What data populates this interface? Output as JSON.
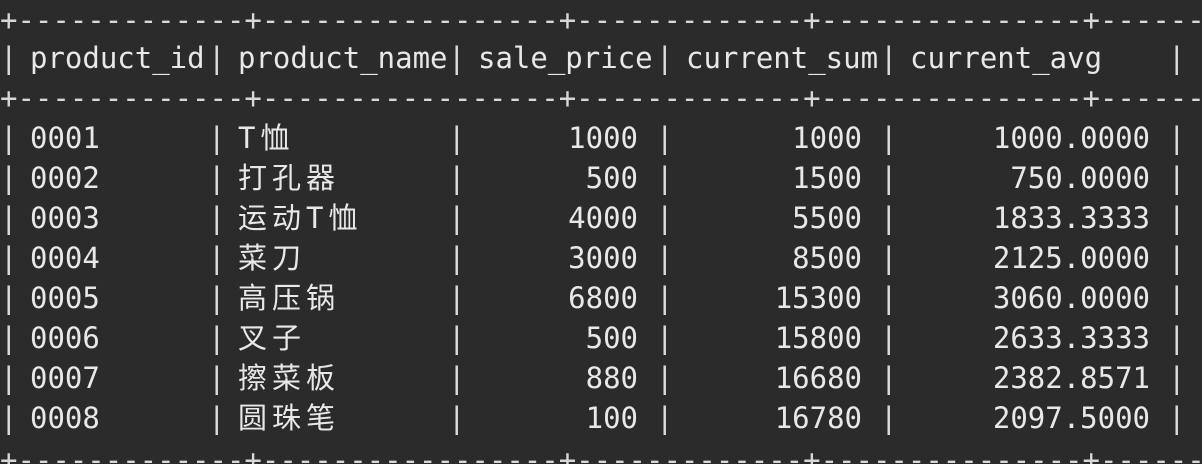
{
  "table": {
    "border_top": "+-------------+-----------------+-------------+---------------+-------------------+",
    "border_header": "+-------------+-----------------+-------------+---------------+-------------------+",
    "border_bottom": "+-------------+-----------------+-------------+---------------+-------------------+",
    "pipe": "|",
    "columns": [
      {
        "key": "product_id",
        "label": "product_id"
      },
      {
        "key": "product_name",
        "label": "product_name"
      },
      {
        "key": "sale_price",
        "label": "sale_price"
      },
      {
        "key": "current_sum",
        "label": "current_sum"
      },
      {
        "key": "current_avg",
        "label": "current_avg"
      }
    ],
    "rows": [
      {
        "product_id": "0001",
        "product_name": "T恤",
        "sale_price": "1000",
        "current_sum": "1000",
        "current_avg": "1000.0000"
      },
      {
        "product_id": "0002",
        "product_name": "打孔器",
        "sale_price": "500",
        "current_sum": "1500",
        "current_avg": "750.0000"
      },
      {
        "product_id": "0003",
        "product_name": "运动T恤",
        "sale_price": "4000",
        "current_sum": "5500",
        "current_avg": "1833.3333"
      },
      {
        "product_id": "0004",
        "product_name": "菜刀",
        "sale_price": "3000",
        "current_sum": "8500",
        "current_avg": "2125.0000"
      },
      {
        "product_id": "0005",
        "product_name": "高压锅",
        "sale_price": "6800",
        "current_sum": "15300",
        "current_avg": "3060.0000"
      },
      {
        "product_id": "0006",
        "product_name": "叉子",
        "sale_price": "500",
        "current_sum": "15800",
        "current_avg": "2633.3333"
      },
      {
        "product_id": "0007",
        "product_name": "擦菜板",
        "sale_price": "880",
        "current_sum": "16680",
        "current_avg": "2382.8571"
      },
      {
        "product_id": "0008",
        "product_name": "圆珠笔",
        "sale_price": "100",
        "current_sum": "16780",
        "current_avg": "2097.5000"
      }
    ]
  },
  "colors": {
    "background": "#2b2b2b",
    "text": "#e8e8e8"
  }
}
